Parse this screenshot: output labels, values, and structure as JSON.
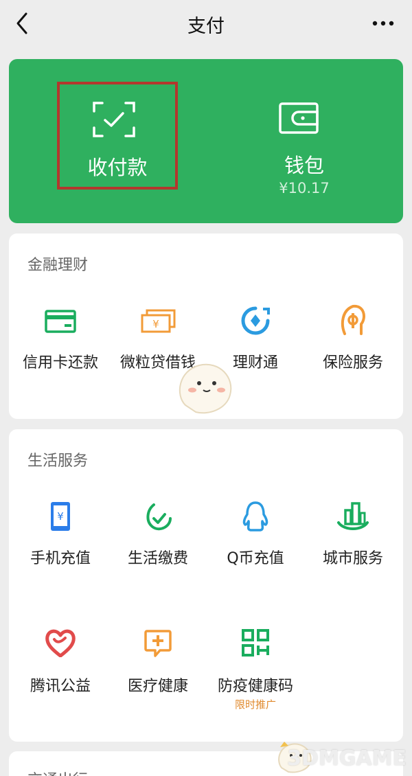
{
  "header": {
    "title": "支付"
  },
  "wallet_card": {
    "pay_label": "收付款",
    "wallet_label": "钱包",
    "wallet_balance": "¥10.17",
    "bg_color": "#2fb05f"
  },
  "finance": {
    "title": "金融理财",
    "items": [
      {
        "label": "信用卡还款",
        "icon": "credit-card-icon",
        "color": "#1aad5e"
      },
      {
        "label": "微粒贷借钱",
        "icon": "loan-bills-icon",
        "color": "#f29b38"
      },
      {
        "label": "理财通",
        "icon": "wealth-icon",
        "color": "#2b9be0"
      },
      {
        "label": "保险服务",
        "icon": "insurance-icon",
        "color": "#f29b38"
      }
    ]
  },
  "life": {
    "title": "生活服务",
    "items": [
      {
        "label": "手机充值",
        "icon": "phone-topup-icon",
        "color": "#2b7de9"
      },
      {
        "label": "生活缴费",
        "icon": "utility-icon",
        "color": "#1aad5e"
      },
      {
        "label": "Q币充值",
        "icon": "qq-penguin-icon",
        "color": "#2b9be0"
      },
      {
        "label": "城市服务",
        "icon": "city-icon",
        "color": "#1aad5e"
      },
      {
        "label": "腾讯公益",
        "icon": "charity-heart-icon",
        "color": "#e14b4b"
      },
      {
        "label": "医疗健康",
        "icon": "medical-icon",
        "color": "#f29b38"
      },
      {
        "label": "防疫健康码",
        "icon": "health-code-icon",
        "color": "#1aad5e",
        "sub": "限时推广"
      }
    ]
  },
  "watermark": "3DMGAME",
  "next_section_peek": "交通出行"
}
